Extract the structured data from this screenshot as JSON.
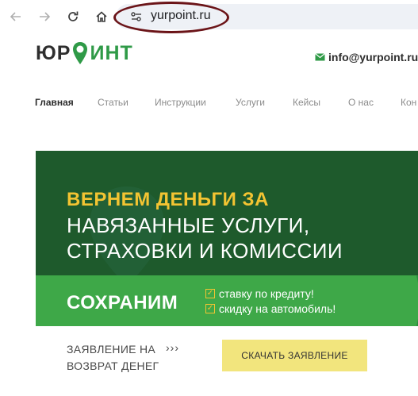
{
  "browser": {
    "url": "yurpoint.ru",
    "icons": [
      "back-arrow-icon",
      "forward-arrow-icon",
      "reload-icon",
      "home-icon",
      "site-settings-icon"
    ]
  },
  "site": {
    "logo_left": "ЮР",
    "logo_pin_letter": "О",
    "logo_right": "ИНТ",
    "email": "info@yurpoint.ru",
    "brand_green": "#2f9a47"
  },
  "menu": {
    "items": [
      {
        "label": "Главная",
        "active": true
      },
      {
        "label": "Статьи",
        "active": false
      },
      {
        "label": "Инструкции",
        "active": false
      },
      {
        "label": "Услуги",
        "active": false
      },
      {
        "label": "Кейсы",
        "active": false
      },
      {
        "label": "О нас",
        "active": false
      },
      {
        "label": "Кон",
        "active": false
      }
    ]
  },
  "banner": {
    "line1": "ВЕРНЕМ ДЕНЬГИ ЗА",
    "line2": "НАВЯЗАННЫЕ УСЛУГИ,",
    "line3": "СТРАХОВКИ И КОМИССИИ",
    "save_word": "СОХРАНИМ",
    "checks": [
      "ставку по кредиту!",
      "скидку на автомобиль!"
    ],
    "colors": {
      "dark_green": "#1e5a2c",
      "light_green": "#3ea848",
      "accent_yellow": "#f3c432"
    }
  },
  "claim": {
    "line1": "ЗАЯВЛЕНИЕ НА",
    "line2": "ВОЗВРАТ ДЕНЕГ",
    "arrows": "›››",
    "button_label": "СКАЧАТЬ ЗАЯВЛЕНИЕ"
  }
}
